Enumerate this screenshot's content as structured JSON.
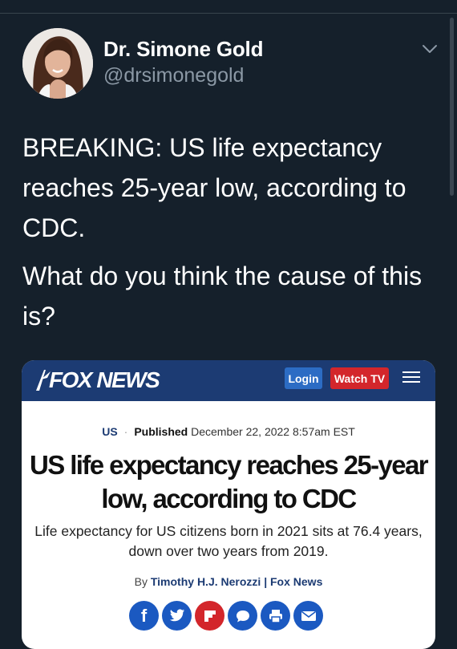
{
  "tweet": {
    "display_name": "Dr. Simone Gold",
    "handle": "@drsimonegold",
    "text_p1": "BREAKING: US life expectancy reaches 25-year low, according to CDC.",
    "text_p2": "What do you think the cause of this is?"
  },
  "card": {
    "brand": "FOX NEWS",
    "login_label": "Login",
    "watch_label": "Watch TV",
    "section": "US",
    "published_label": "Published",
    "published_date": "December 22, 2022 8:57am EST",
    "headline": "US life expectancy reaches 25-year low, according to CDC",
    "subhead": "Life expectancy for US citizens born in 2021 sits at 76.4 years, down over two years from 2019.",
    "byline_prefix": "By",
    "author": "Timothy H.J. Nerozzi",
    "byline_sep": "|",
    "outlet": "Fox News"
  },
  "colors": {
    "background": "#15202b",
    "fox_blue": "#1c3b73",
    "fox_red": "#d3262b",
    "share_blue": "#1b59c1"
  },
  "icons": [
    "chevron-down-icon",
    "hamburger-menu-icon",
    "facebook-icon",
    "twitter-icon",
    "flipboard-icon",
    "comment-icon",
    "print-icon",
    "email-icon"
  ]
}
